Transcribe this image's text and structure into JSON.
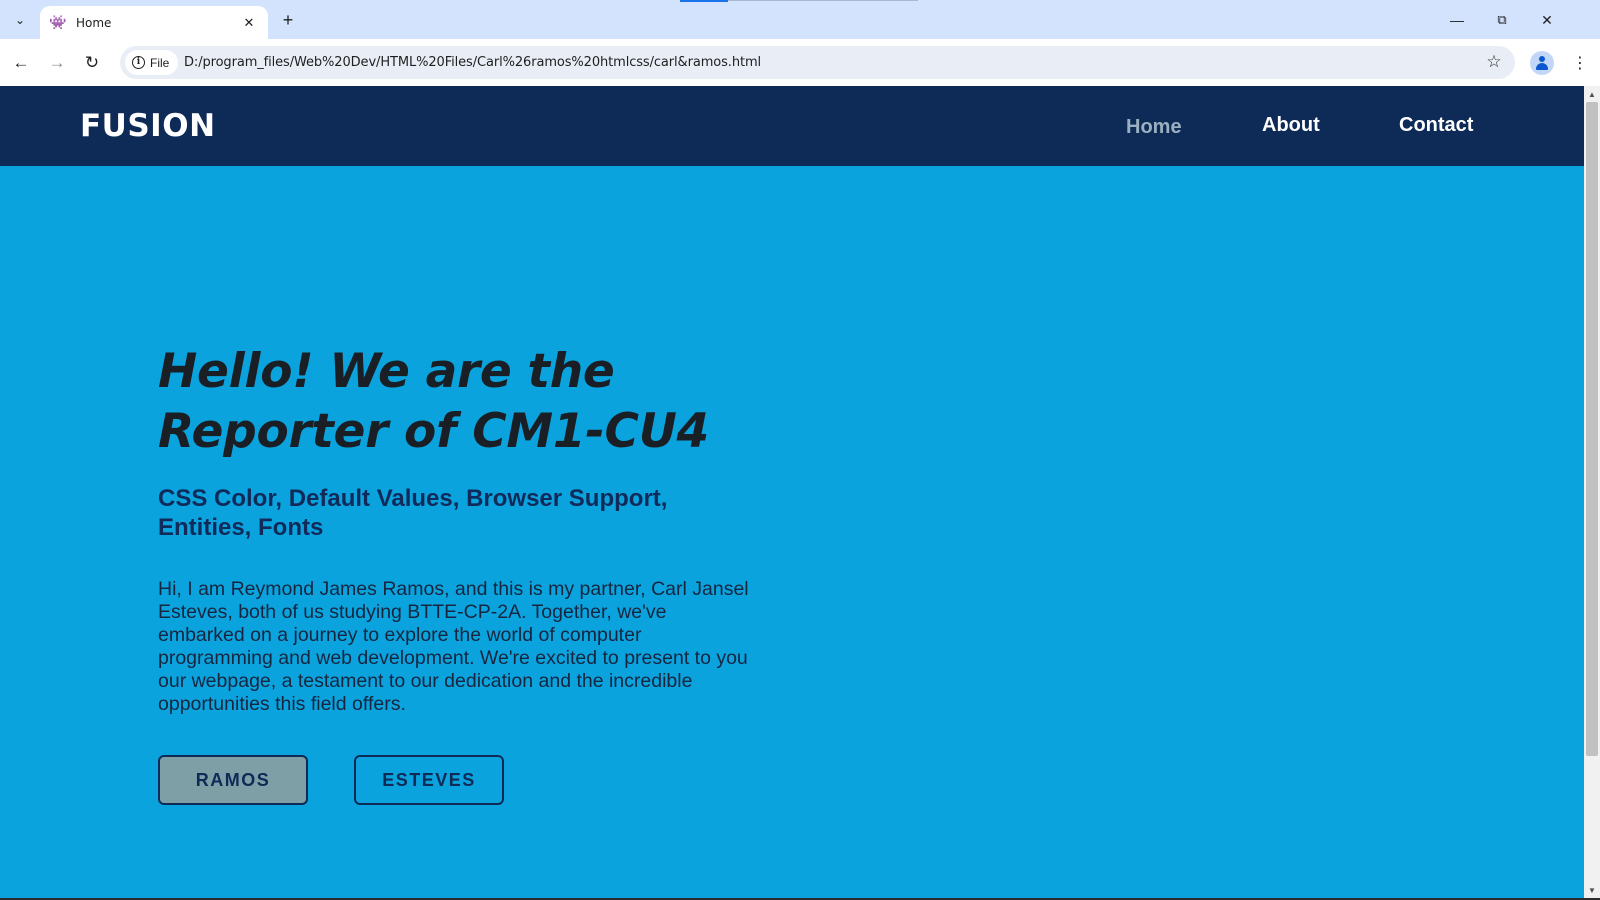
{
  "browser": {
    "tab_title": "Home",
    "site_chip_label": "File",
    "url": "D:/program_files/Web%20Dev/HTML%20Files/Carl%26ramos%20htmlcss/carl&ramos.html",
    "icons": {
      "tab_search": "chevron-down-icon",
      "favicon": "space-invader-icon",
      "tab_close": "close-icon",
      "new_tab": "plus-icon",
      "back": "arrow-left-icon",
      "forward": "arrow-right-icon",
      "reload": "reload-icon",
      "site_info": "info-icon",
      "bookmark": "star-icon",
      "profile": "profile-icon",
      "menu": "kebab-menu-icon",
      "minimize": "minimize-icon",
      "restore": "restore-icon",
      "close_window": "close-icon"
    }
  },
  "site": {
    "brand": "FUSION",
    "nav": {
      "home": "Home",
      "about": "About",
      "contact": "Contact"
    },
    "colors": {
      "header_bg": "#0e2a56",
      "page_bg": "#0ba3de",
      "active_nav": "#9ab0c0",
      "button_fill": "#7f9fa6"
    }
  },
  "hero": {
    "title_line1": "Hello! We are the",
    "title_line2": "Reporter of CM1-CU4",
    "subtitle": "CSS Color, Default Values, Browser Support, Entities, Fonts",
    "body": "Hi, I am Reymond James Ramos, and this is my partner, Carl Jansel Esteves, both of us studying BTTE-CP-2A. Together, we've embarked on a journey to explore the world of computer programming and web development. We're excited to present to you our webpage, a testament to our dedication and the incredible opportunities this field offers.",
    "buttons": {
      "ramos": "RAMOS",
      "esteves": "ESTEVES"
    }
  }
}
